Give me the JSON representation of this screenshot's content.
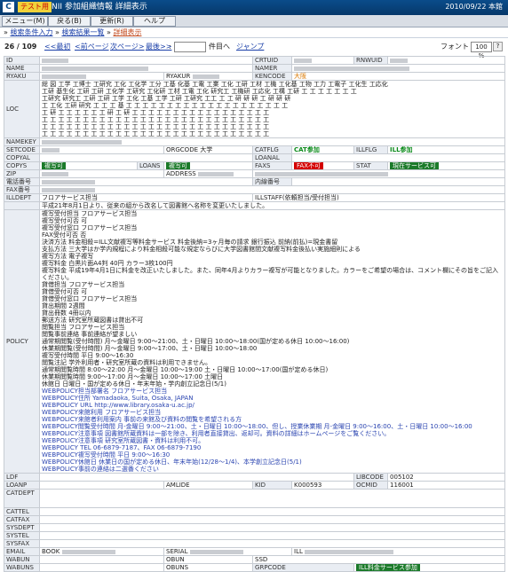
{
  "titlebar": {
    "logo": "C",
    "tag": "テスト用",
    "title": "NII 参加組織情報 詳細表示",
    "date": "2010/09/22 本館"
  },
  "menu": {
    "items": [
      "メニュー(M)",
      "戻る(B)",
      "更新(R)",
      "ヘルプ"
    ]
  },
  "breadcrumb": {
    "link1": "検索条件入力",
    "link2": "検索結果一覧",
    "current": "詳細表示"
  },
  "nav": {
    "count": "26 / 109",
    "first": "<<最初",
    "prev": "<前ページ",
    "next": "次ページ>",
    "last": "最後>>",
    "colon": ":",
    "unit": "件目へ",
    "jump": "ジャンプ",
    "font_label": "フォント",
    "font_value": "100 %",
    "help": "?"
  },
  "fields": {
    "id": "ID",
    "name": "NAME",
    "ryaku": "RYAKU",
    "loc": "LOC",
    "namekey": "NAMEKEY",
    "setcode": "SETCODE",
    "copyal": "COPYAL",
    "copys": "COPYS",
    "zip": "ZIP",
    "tel": "電話番号",
    "fax": "FAX番号",
    "illdept": "ILLDEPT",
    "policy": "POLICY",
    "ldf": "LDF",
    "loanp": "LOANP",
    "catdept": "CATDEPT",
    "cattel": "CATTEL",
    "catfax": "CATFAX",
    "sysdept": "SYSDEPT",
    "systel": "SYSTEL",
    "sysfax": "SYSFAX",
    "email": "EMAIL",
    "wabun": "WABUN",
    "wabuns": "WABUNS"
  },
  "subfields": {
    "crtuid": "CRTUID",
    "rnwuid": "RNWUID",
    "name_r": "NAMER",
    "ryakur": "RYAKUR",
    "kenmei": "大阪",
    "kencode": "KENCODE",
    "orgcode": "ORGCODE",
    "orgcode_val": "大学",
    "catflg": "CATFLG",
    "catflg_val": "CAT参加",
    "illflg": "ILLFLG",
    "illflg_val": "ILL参加",
    "loanal": "LOANAL",
    "loans": "LOANS",
    "loans_val": "複写可",
    "faxs": "FAXS",
    "faxs_val": "FAX不可",
    "stat": "STAT",
    "stat_val": "現在サービス可",
    "address": "ADDRESS",
    "naisen": "内線番号",
    "illstaff": "ILLSTAFF(依頼担当/受付担当)",
    "copys_val": "複写可",
    "amlide": "AMLIDE",
    "kid": "KID",
    "kid_val": "K000593",
    "ocmid": "OCMID",
    "ocmid_val": "116001",
    "libcode": "LIBCODE",
    "libcode_val": "005102",
    "book": "BOOK",
    "serial": "SERIAL",
    "ill": "ILL",
    "obun": "OBUN",
    "obuns": "OBUNS",
    "ssd": "SSD",
    "grpcode": "GRPCODE",
    "grpcode_val": "ILL料金サービス参加"
  },
  "illdept_lines": [
    "フロアサービス担当",
    "平成21年8月1日より、従来の組から改名して図書館へ名称を変更いたしました。"
  ],
  "policy_lines": [
    "複写受付担当 フロアサービス担当",
    "複写受付可否 可",
    "複写受付窓口 フロアサービス担当",
    "FAX受付可否 否",
    "決済方法 料金相殺=ILL文献複写等料金サービス 料金後納=3ヶ月毎の請求 銀行振込 前納(前払)=現金書留",
    "支払方法 三大学はか学内規程により料金相殺可能な規定ならびに大学図書館間文献複写料金後払い実施細則による",
    "複写方法 電子複写",
    "複写料金 白黒片面A4判 40円 カラー3枚100円",
    "複写料金 平成19年4月1日に料金を改正いたしました。また、同年4月よりカラー複写が可能となりました。カラーをご希望の場合は、コメント欄にその旨をご記入ください。",
    "貸借担当 フロアサービス担当",
    "貸借受付可否 可",
    "貸借受付窓口 フロアサービス担当",
    "貸出期間 2週間",
    "貸出冊数 4冊以内",
    "郵送方法 研究室所蔵図書は貸出不可",
    "閲覧担当 フロアサービス担当",
    "閲覧事前連絡 事前連絡が望ましい",
    "通常期閲覧(受付時間) 月～金曜日 9:00～21:00、土・日曜日 10:00～18:00(国が定める休日 10:00～16:00)",
    "休業期閲覧(受付時間) 月～金曜日 9:00～17:00、土・日曜日 10:00～18:00",
    "複写受付時間 平日 9:00～16:30",
    "閲覧注記 学外利用者・研究室所蔵の資料は利用できません。",
    "通常期閲覧時間 8:00～22:00 月～金曜日 10:00～19:00 土・日曜日 10:00～17:00(国が定める休日)",
    "休業期閲覧時間 9:00～17:00 月～金曜日 10:00～17:00 土曜日",
    "休館日 日曜日・国が定める休日・年末年始・学内創立記念日(5/1)"
  ],
  "webpolicy_lines": [
    "WEBPOLICY担当部署名 フロアサービス担当",
    "WEBPOLICY住所 Yamadaoka, Suita, Osaka, JAPAN",
    "WEBPOLICY URL http://www.library.osaka-u.ac.jp/",
    "WEBPOLICY来館利用 フロアサービス担当",
    "WEBPOLICY来館者利用案内 事前の来館及び資料の閲覧を希望される方",
    "WEBPOLICY閲覧受付時間 月-金曜日 9:00～21:00、土・日曜日 10:00～18:00、但し、授業休業期 月-金曜日 9:00～16:00、土・日曜日 10:00～16:00",
    "WEBPOLICY注意事項 図書館所蔵資料は一部を除き、利用者直接貸出、返却可。資料の詳細はホームページをご覧ください。",
    "WEBPOLICY注意事項 研究室所蔵図書・資料は利用不可。",
    "WEBPOLICY TEL 06-6879-7187、FAX 06-6879-7190",
    "WEBPOLICY複写受付時間 平日 9:00～16:30",
    "WEBPOLICY休館日 休業日の国が定める休日、年末年始(12/28～1/4)、本学創立記念日(5/1)",
    "WEBPOLICY事前の連絡は二選番ください"
  ],
  "loc_lines": [
    "総 図 工学 工博士 工研究 工化 工化学 工分 工基 化基 工電 工業 工化 工研 工材 工機 工化基 工物 工力 工電子 工化生 工応化",
    "工研 基生化 工研 工研 工化学 工研究 工化研 工材 工電 工化 研究工 工機研 工応化 工構 工研 工 工 工 工 工 工 工",
    "工研究 研究工 工研 工研 工学 工化 工基 工学 工研 工研究 工工 工 工 研 研 研 工 研 研 研",
    "工 工化 工研 研究 工 工 工 基 工 工 工 工 工 工 工 工 工 工 工 工 工 工 工 工 工 工 工 工",
    "工 研 工 工 工 工 工 工 研 工 研 工 工 工 工 工 工 工 工 工 工 工 工 工 工 工 工 工",
    "工 工 工 工 工 工 工 工 工 工 工 工 工 工 工 工 工 工 工 工 工 工 工 工 工 工 工 工",
    "工 工 工 工 工 工 工 工 工 工 工 工 工 工 工 工 工 工 工 工 工 工 工 工 工 工 工 工",
    "工 工 工 工 工 工 工 工 工 工 工 工 工 工 工 工 工 工 工 工 工 工 工 工 工 工 工 工"
  ]
}
